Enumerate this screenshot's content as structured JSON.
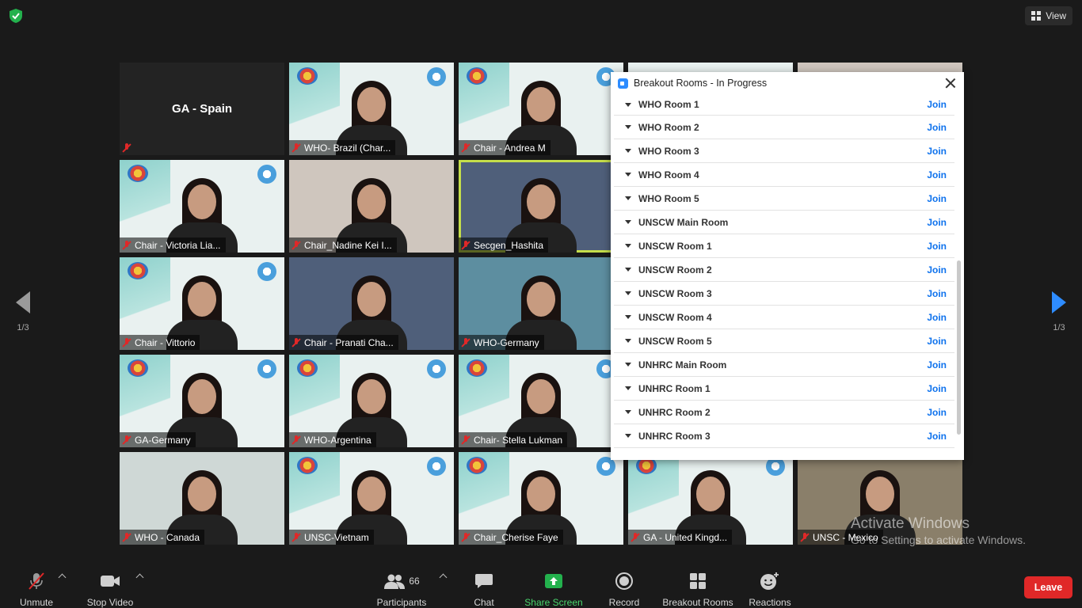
{
  "top_bar": {
    "view_label": "View"
  },
  "tiles": [
    {
      "name": "GA - Spain",
      "style": "dark",
      "center_name": true
    },
    {
      "name": "WHO- Brazil (Char...",
      "style": "white"
    },
    {
      "name": "Chair - Andrea M",
      "style": "white"
    },
    {
      "name": "",
      "style": "white"
    },
    {
      "name": "",
      "style": "room"
    },
    {
      "name": "Chair - Victoria Lia...",
      "style": "white"
    },
    {
      "name": "Chair_Nadine Kei I...",
      "style": "room"
    },
    {
      "name": "Secgen_Hashita",
      "style": "blue",
      "active": true
    },
    {
      "name": "",
      "style": "white"
    },
    {
      "name": "",
      "style": "room"
    },
    {
      "name": "Chair - Vittorio",
      "style": "white"
    },
    {
      "name": "Chair - Pranati Cha...",
      "style": "blue"
    },
    {
      "name": "WHO-Germany",
      "style": "teal"
    },
    {
      "name": "",
      "style": "white"
    },
    {
      "name": "",
      "style": "room"
    },
    {
      "name": "GA-Germany",
      "style": "white"
    },
    {
      "name": "WHO-Argentina",
      "style": "white"
    },
    {
      "name": "Chair- Stella Lukman",
      "style": "white"
    },
    {
      "name": "",
      "style": "white"
    },
    {
      "name": "",
      "style": "room"
    },
    {
      "name": "WHO - Canada",
      "style": "frame"
    },
    {
      "name": "UNSC-Vietnam",
      "style": "white"
    },
    {
      "name": "Chair_Cherise Faye",
      "style": "white"
    },
    {
      "name": "GA - United Kingd...",
      "style": "white"
    },
    {
      "name": "UNSC - Mexico",
      "style": "orange"
    }
  ],
  "pagination": {
    "left": "1/3",
    "right": "1/3"
  },
  "breakout": {
    "title": "Breakout Rooms - In Progress",
    "join_label": "Join",
    "rooms": [
      "WHO Room 1",
      "WHO Room 2",
      "WHO Room 3",
      "WHO Room 4",
      "WHO Room 5",
      "UNSCW Main Room",
      "UNSCW Room 1",
      "UNSCW Room 2",
      "UNSCW Room 3",
      "UNSCW Room 4",
      "UNSCW Room 5",
      "UNHRC Main Room",
      "UNHRC Room 1",
      "UNHRC Room 2",
      "UNHRC Room 3"
    ]
  },
  "watermark": {
    "line1": "Activate Windows",
    "line2": "Go to Settings to activate Windows."
  },
  "toolbar": {
    "unmute": "Unmute",
    "stop_video": "Stop Video",
    "participants": "Participants",
    "participants_count": "66",
    "chat": "Chat",
    "share_screen": "Share Screen",
    "record": "Record",
    "breakout_rooms": "Breakout Rooms",
    "reactions": "Reactions",
    "leave": "Leave"
  },
  "colors": {
    "accent": "#0e72ed",
    "share_green": "#4ad66d",
    "leave_red": "#e02828",
    "active_speaker": "#c5de4a"
  }
}
